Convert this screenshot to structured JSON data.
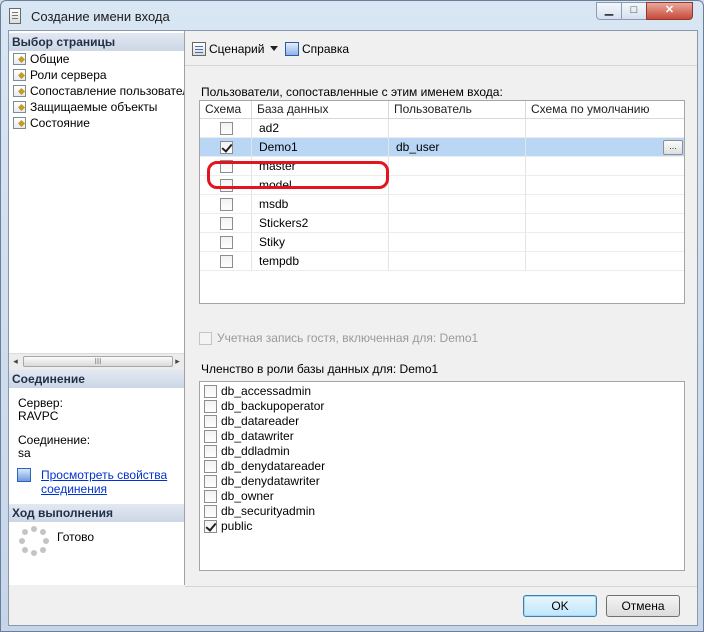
{
  "window": {
    "title": "Создание имени входа",
    "min_glyph": "▁",
    "max_glyph": "□",
    "close_glyph": "✕"
  },
  "sidebar": {
    "pages_header": "Выбор страницы",
    "items": [
      {
        "label": "Общие",
        "icon": "page-icon"
      },
      {
        "label": "Роли сервера",
        "icon": "page-icon"
      },
      {
        "label": "Сопоставление пользователей",
        "icon": "page-icon"
      },
      {
        "label": "Защищаемые объекты",
        "icon": "page-icon"
      },
      {
        "label": "Состояние",
        "icon": "page-icon"
      }
    ],
    "scroll_left": "◂",
    "scroll_right": "▸",
    "scroll_grip": "III",
    "connection_header": "Соединение",
    "server_label": "Сервер:",
    "server_value": "RAVPC",
    "connection_label": "Соединение:",
    "connection_value": "sa",
    "view_props_line1": "Просмотреть свойства",
    "view_props_line2": "соединения",
    "progress_header": "Ход выполнения",
    "progress_status": "Готово"
  },
  "toolbar": {
    "script_label": "Сценарий",
    "help_label": "Справка"
  },
  "mapping": {
    "title": "Пользователи, сопоставленные с этим именем входа:",
    "columns": [
      "Схема",
      "База данных",
      "Пользователь",
      "Схема по умолчанию"
    ],
    "rows": [
      {
        "checked": false,
        "database": "ad2",
        "user": "",
        "schema": ""
      },
      {
        "checked": true,
        "database": "Demo1",
        "user": "db_user",
        "schema": ""
      },
      {
        "checked": false,
        "database": "master",
        "user": "",
        "schema": ""
      },
      {
        "checked": false,
        "database": "model",
        "user": "",
        "schema": ""
      },
      {
        "checked": false,
        "database": "msdb",
        "user": "",
        "schema": ""
      },
      {
        "checked": false,
        "database": "Stickers2",
        "user": "",
        "schema": ""
      },
      {
        "checked": false,
        "database": "Stiky",
        "user": "",
        "schema": ""
      },
      {
        "checked": false,
        "database": "tempdb",
        "user": "",
        "schema": ""
      }
    ],
    "ellipsis_label": "...",
    "selected_index": 1
  },
  "guest": {
    "label": "Учетная запись гостя, включенная для: Demo1",
    "checked": false
  },
  "roles": {
    "title": "Членство в роли базы данных для: Demo1",
    "items": [
      {
        "name": "db_accessadmin",
        "checked": false
      },
      {
        "name": "db_backupoperator",
        "checked": false
      },
      {
        "name": "db_datareader",
        "checked": false
      },
      {
        "name": "db_datawriter",
        "checked": false
      },
      {
        "name": "db_ddladmin",
        "checked": false
      },
      {
        "name": "db_denydatareader",
        "checked": false
      },
      {
        "name": "db_denydatawriter",
        "checked": false
      },
      {
        "name": "db_owner",
        "checked": false
      },
      {
        "name": "db_securityadmin",
        "checked": false
      },
      {
        "name": "public",
        "checked": true
      }
    ]
  },
  "buttons": {
    "ok": "OK",
    "cancel": "Отмена"
  },
  "colors": {
    "selection": "#b9d6f5",
    "highlight_ring": "#e3141e",
    "link": "#0033cc",
    "ok_border": "#3c7fb1"
  }
}
